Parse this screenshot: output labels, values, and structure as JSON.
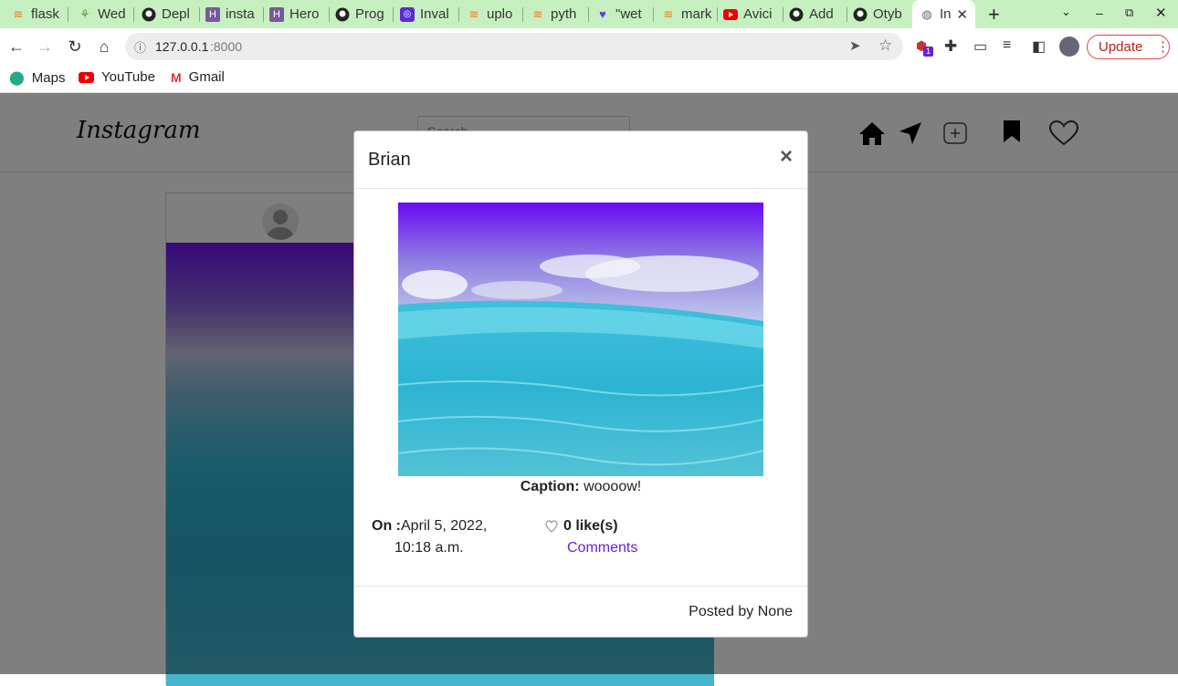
{
  "browser": {
    "tabs": [
      {
        "label": "flask",
        "icon": "stackoverflow-icon"
      },
      {
        "label": "Wed",
        "icon": "palm-icon"
      },
      {
        "label": "Depl",
        "icon": "github-icon"
      },
      {
        "label": "insta",
        "icon": "heroku-icon"
      },
      {
        "label": "Hero",
        "icon": "heroku-icon"
      },
      {
        "label": "Prog",
        "icon": "github-icon"
      },
      {
        "label": "Inval",
        "icon": "podcast-icon"
      },
      {
        "label": "uplo",
        "icon": "stackoverflow-icon"
      },
      {
        "label": "pyth",
        "icon": "stackoverflow-icon"
      },
      {
        "label": "\"wet",
        "icon": "twitter-icon"
      },
      {
        "label": "mark",
        "icon": "stackoverflow-icon"
      },
      {
        "label": "Avici",
        "icon": "youtube-icon"
      },
      {
        "label": "Add",
        "icon": "github-icon"
      },
      {
        "label": "Otyb",
        "icon": "github-icon"
      },
      {
        "label": "In",
        "icon": "globe-icon"
      }
    ],
    "url_host": "127.0.0.1",
    "url_port": ":8000",
    "update_label": "Update",
    "extension_badge": "1",
    "bookmarks": [
      {
        "label": "Maps"
      },
      {
        "label": "YouTube"
      },
      {
        "label": "Gmail"
      }
    ]
  },
  "app": {
    "logo": "Instagram",
    "search_placeholder": "Search"
  },
  "modal": {
    "title": "Brian",
    "close": "×",
    "caption_label": "Caption:",
    "caption_text": "woooow!",
    "date_label": "On :",
    "date_line1": "April 5, 2022,",
    "date_line2": "10:18 a.m.",
    "likes": "0 like(s)",
    "comments_link": "Comments",
    "footer": "Posted by None"
  },
  "colors": {
    "tabbar": "#c7f0c0",
    "link": "#6a1fd6",
    "overlay": "rgba(0,0,0,0.5)",
    "update": "#b3261e"
  }
}
